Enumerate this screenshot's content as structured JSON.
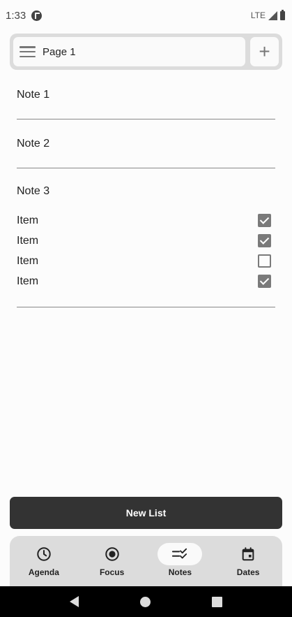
{
  "status_bar": {
    "time": "1:33",
    "network": "LTE"
  },
  "top_bar": {
    "page_name": "Page 1",
    "add_symbol": "+"
  },
  "notes": [
    {
      "title": "Note 1"
    },
    {
      "title": "Note 2"
    },
    {
      "title": "Note 3",
      "items": [
        {
          "label": "Item",
          "checked": true
        },
        {
          "label": "Item",
          "checked": true
        },
        {
          "label": "Item",
          "checked": false
        },
        {
          "label": "Item",
          "checked": true
        }
      ]
    }
  ],
  "new_list_label": "New List",
  "bottom_nav": {
    "active": "Notes",
    "items": [
      {
        "label": "Agenda",
        "icon": "clock-icon"
      },
      {
        "label": "Focus",
        "icon": "target-icon"
      },
      {
        "label": "Notes",
        "icon": "checklist-icon"
      },
      {
        "label": "Dates",
        "icon": "calendar-icon"
      }
    ]
  },
  "colors": {
    "accent": "#333333",
    "surface": "#dcdcdc",
    "background": "#fcfcfc"
  }
}
